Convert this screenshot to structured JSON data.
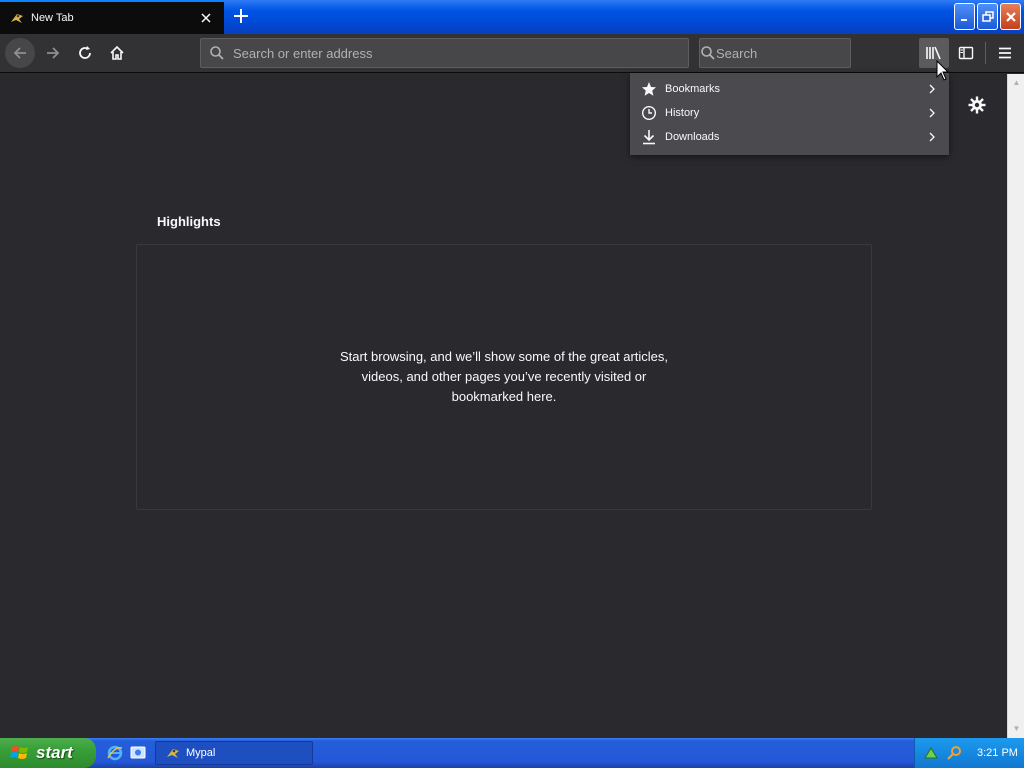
{
  "tab": {
    "title": "New Tab",
    "close_icon": "close-icon"
  },
  "window": {
    "minimize": "minimize-icon",
    "maximize": "restore-icon",
    "close": "close-icon"
  },
  "toolbar": {
    "address_placeholder": "Search or enter address",
    "search_placeholder": "Search"
  },
  "library_menu": {
    "items": [
      {
        "label": "Bookmarks",
        "icon": "star-icon"
      },
      {
        "label": "History",
        "icon": "clock-icon"
      },
      {
        "label": "Downloads",
        "icon": "download-icon"
      }
    ]
  },
  "content": {
    "highlights_title": "Highlights",
    "empty_message": "Start browsing, and we’ll show some of the great articles, videos, and other pages you’ve recently visited or bookmarked here."
  },
  "taskbar": {
    "start_label": "start",
    "task_label": "Mypal",
    "clock": "3:21 PM"
  },
  "colors": {
    "accent": "#0a84ff",
    "background": "#2a2a2e",
    "toolbar": "#323234",
    "menu": "#4a4a4f"
  }
}
